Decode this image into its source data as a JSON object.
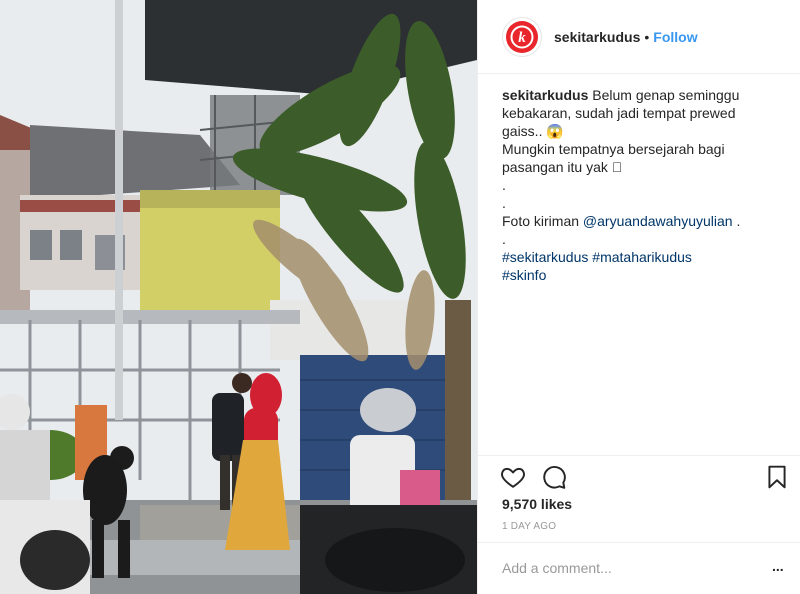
{
  "post": {
    "photo_alt": "",
    "header": {
      "avatar_letter": "k",
      "username": "sekitarkudus",
      "separator": "•",
      "follow_label": "Follow"
    },
    "caption": {
      "username": "sekitarkudus",
      "line1": "Belum genap seminggu",
      "line2": "kebakaran, sudah jadi tempat prewed",
      "line3": "gaiss.. 😱",
      "line4": "Mungkin tempatnya bersejarah bagi",
      "line5": "pasangan itu yak 🏻",
      "dot1": ".",
      "dot2": ".",
      "credit_prefix": "Foto kiriman ",
      "credit_mention": "@aryuandawahyuyulian",
      "credit_suffix": " .",
      "dot3": ".",
      "hashtag1": "#sekitarkudus",
      "hashtag2": "#mataharikudus",
      "hashtag3": "#skinfo"
    },
    "actions": {
      "like_icon": "heart-outline-icon",
      "comment_icon": "speech-bubble-icon",
      "save_icon": "bookmark-icon"
    },
    "likes": "9,570 likes",
    "time_ago": "1 DAY AGO",
    "comment_placeholder": "Add a comment...",
    "more_label": "..."
  },
  "colors": {
    "link": "#003569",
    "follow": "#3897f0",
    "brand_red": "#e8262b",
    "muted": "#999999",
    "border": "#efefef"
  }
}
